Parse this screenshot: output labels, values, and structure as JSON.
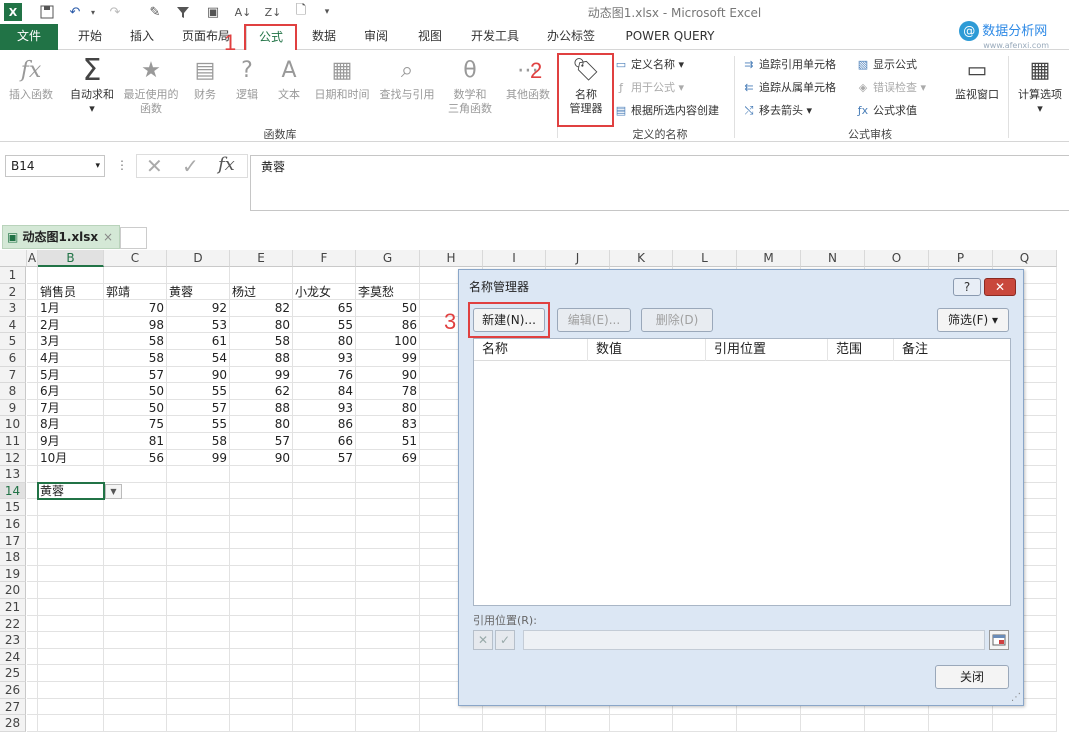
{
  "window": {
    "title": "动态图1.xlsx - Microsoft Excel"
  },
  "watermark": {
    "name": "数据分析网",
    "url": "www.afenxi.com",
    "mark": "@"
  },
  "tabs": [
    {
      "label": "文件"
    },
    {
      "label": "开始"
    },
    {
      "label": "插入"
    },
    {
      "label": "页面布局"
    },
    {
      "label": "公式"
    },
    {
      "label": "数据"
    },
    {
      "label": "审阅"
    },
    {
      "label": "视图"
    },
    {
      "label": "开发工具"
    },
    {
      "label": "办公标签"
    },
    {
      "label": "POWER QUERY"
    }
  ],
  "annotations": {
    "n1": "1",
    "n2": "2",
    "n3": "3"
  },
  "ribbon": {
    "insert_function": "插入函数",
    "autosum": "自动求和",
    "recent_1": "最近使用的",
    "recent_2": "函数",
    "finance": "财务",
    "logic": "逻辑",
    "text": "文本",
    "datetime": "日期和时间",
    "lookup": "查找与引用",
    "math_1": "数学和",
    "math_2": "三角函数",
    "other": "其他函数",
    "group_library": "函数库",
    "name_mgr_1": "名称",
    "name_mgr_2": "管理器",
    "define_name": "定义名称",
    "use_in_formula": "用于公式",
    "create_from_sel": "根据所选内容创建",
    "group_names": "定义的名称",
    "trace_precedents": "追踪引用单元格",
    "trace_dependents": "追踪从属单元格",
    "remove_arrows": "移去箭头",
    "show_formulas": "显示公式",
    "error_check": "错误检查",
    "eval_formula": "公式求值",
    "group_audit": "公式审核",
    "watch_window": "监视窗口",
    "calc_options": "计算选项"
  },
  "formula_bar": {
    "cell_ref": "B14",
    "value": "黄蓉"
  },
  "workbook_tab": {
    "label": "动态图1.xlsx"
  },
  "sheet": {
    "columns": [
      "A",
      "B",
      "C",
      "D",
      "E",
      "F",
      "G",
      "H",
      "I",
      "J",
      "K",
      "L",
      "M",
      "N",
      "O",
      "P",
      "Q"
    ],
    "rows": [
      "1",
      "2",
      "3",
      "4",
      "5",
      "6",
      "7",
      "8",
      "9",
      "10",
      "11",
      "12",
      "13",
      "14",
      "15",
      "16",
      "17",
      "18",
      "19",
      "20",
      "21",
      "22",
      "23",
      "24",
      "25",
      "26",
      "27",
      "28"
    ],
    "header": [
      "销售员",
      "郭靖",
      "黄蓉",
      "杨过",
      "小龙女",
      "李莫愁"
    ],
    "data": [
      [
        "1月",
        "70",
        "92",
        "82",
        "65",
        "50"
      ],
      [
        "2月",
        "98",
        "53",
        "80",
        "55",
        "86"
      ],
      [
        "3月",
        "58",
        "61",
        "58",
        "80",
        "100"
      ],
      [
        "4月",
        "58",
        "54",
        "88",
        "93",
        "99"
      ],
      [
        "5月",
        "57",
        "90",
        "99",
        "76",
        "90"
      ],
      [
        "6月",
        "50",
        "55",
        "62",
        "84",
        "78"
      ],
      [
        "7月",
        "50",
        "57",
        "88",
        "93",
        "80"
      ],
      [
        "8月",
        "75",
        "55",
        "80",
        "86",
        "83"
      ],
      [
        "9月",
        "81",
        "58",
        "57",
        "66",
        "51"
      ],
      [
        "10月",
        "56",
        "99",
        "90",
        "57",
        "69"
      ]
    ],
    "b14": "黄蓉"
  },
  "dialog": {
    "title": "名称管理器",
    "help": "?",
    "new_btn": "新建(N)...",
    "edit_btn": "编辑(E)...",
    "delete_btn": "删除(D)",
    "filter_btn": "筛选(F) ▾",
    "cols": [
      "名称",
      "数值",
      "引用位置",
      "范围",
      "备注"
    ],
    "ref_label": "引用位置(R):",
    "close_btn": "关闭"
  }
}
